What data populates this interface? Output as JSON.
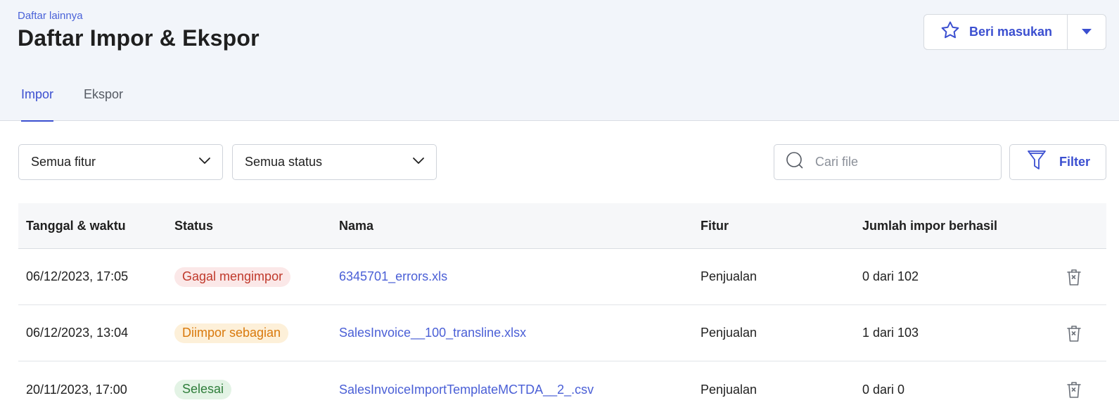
{
  "header": {
    "breadcrumb": "Daftar lainnya",
    "title": "Daftar Impor & Ekspor",
    "feedback_label": "Beri masukan"
  },
  "tabs": [
    {
      "label": "Impor",
      "active": true
    },
    {
      "label": "Ekspor",
      "active": false
    }
  ],
  "filters": {
    "feature_select": "Semua fitur",
    "status_select": "Semua status",
    "search_placeholder": "Cari file",
    "filter_label": "Filter"
  },
  "table": {
    "columns": [
      "Tanggal & waktu",
      "Status",
      "Nama",
      "Fitur",
      "Jumlah impor berhasil"
    ],
    "rows": [
      {
        "datetime": "06/12/2023, 17:05",
        "status": "Gagal mengimpor",
        "status_type": "fail",
        "name": "6345701_errors.xls",
        "feature": "Penjualan",
        "count": "0 dari 102"
      },
      {
        "datetime": "06/12/2023, 13:04",
        "status": "Diimpor sebagian",
        "status_type": "partial",
        "name": "SalesInvoice__100_transline.xlsx",
        "feature": "Penjualan",
        "count": "1 dari 103"
      },
      {
        "datetime": "20/11/2023, 17:00",
        "status": "Selesai",
        "status_type": "done",
        "name": "SalesInvoiceImportTemplateMCTDA__2_.csv",
        "feature": "Penjualan",
        "count": "0 dari 0"
      }
    ]
  },
  "colors": {
    "accent": "#3b4fd0",
    "header_bg": "#f2f5fa",
    "fail": "#c0392b",
    "partial": "#d9790c",
    "done": "#2e7d3a"
  },
  "icons": {
    "feedback": "star-icon",
    "dropdown": "caret-down-icon",
    "select": "chevron-down-icon",
    "search": "search-icon",
    "filter": "filter-icon",
    "delete": "trash-icon"
  }
}
